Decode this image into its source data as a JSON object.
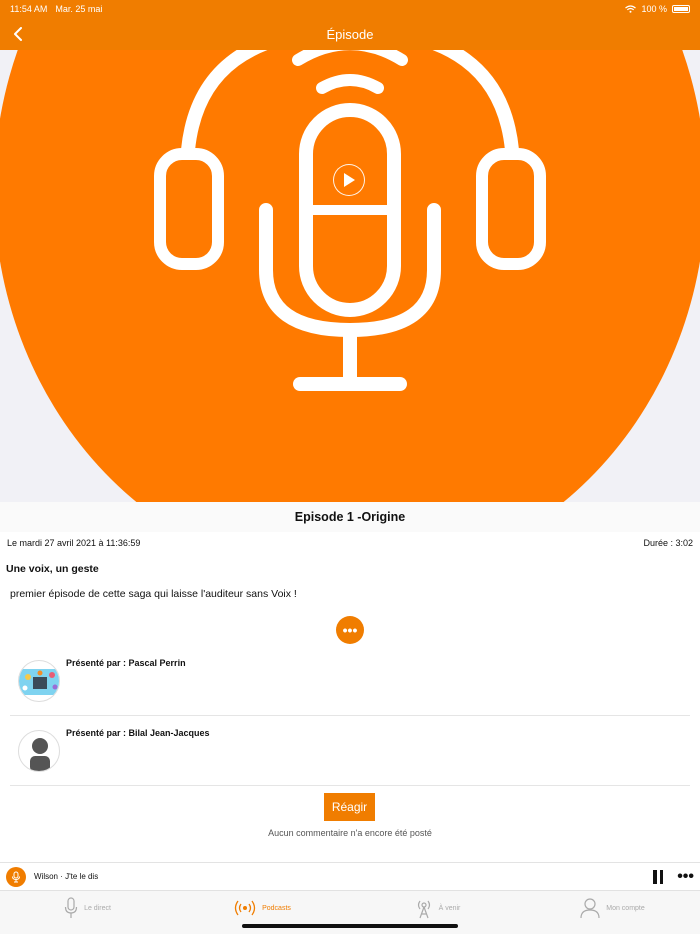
{
  "status_bar": {
    "time": "11:54 AM",
    "date": "Mar. 25 mai",
    "battery": "100 %"
  },
  "nav": {
    "title": "Épisode"
  },
  "episode": {
    "title": "Episode 1 -Origine",
    "date": "Le mardi 27 avril 2021 à 11:36:59",
    "duration": "Durée : 3:02",
    "subtitle": "Une voix, un geste",
    "description": "premier épisode de cette saga qui laisse l'auditeur sans Voix !"
  },
  "presenters": [
    {
      "label": "Présenté par : Pascal Perrin"
    },
    {
      "label": "Présenté par : Bilal Jean-Jacques"
    }
  ],
  "comments": {
    "react_label": "Réagir",
    "empty_text": "Aucun commentaire n'a encore été posté"
  },
  "mini_player": {
    "title": "Wilson · J'te le dis"
  },
  "tabs": [
    {
      "label": "Le direct"
    },
    {
      "label": "Podcasts"
    },
    {
      "label": "À venir"
    },
    {
      "label": "Mon compte"
    }
  ],
  "colors": {
    "accent": "#f07d00",
    "hero": "#ff7a00"
  }
}
